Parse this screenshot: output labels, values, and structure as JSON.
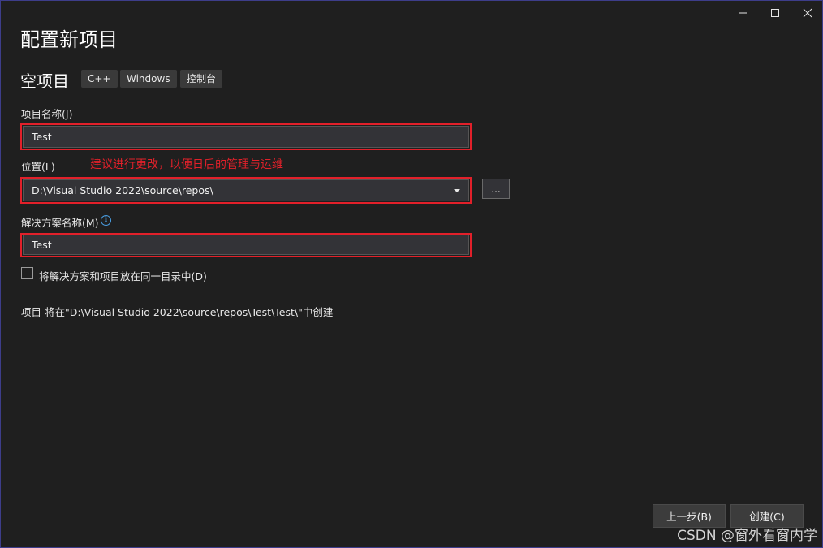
{
  "window": {
    "title": "配置新项目",
    "controls": [
      "minimize-icon",
      "maximize-icon",
      "close-icon"
    ]
  },
  "template": {
    "name": "空项目",
    "tags": [
      "C++",
      "Windows",
      "控制台"
    ]
  },
  "project_name": {
    "label": "项目名称(J)",
    "value": "Test"
  },
  "location": {
    "label": "位置(L)",
    "value": "D:\\Visual Studio 2022\\source\\repos\\",
    "browse_label": "..."
  },
  "annotation": "建议进行更改，以便日后的管理与运维",
  "solution_name": {
    "label": "解决方案名称(M)",
    "value": "Test",
    "info_icon": "info-icon"
  },
  "same_dir_checkbox": {
    "label": "将解决方案和项目放在同一目录中(D)",
    "checked": false
  },
  "summary": "项目 将在\"D:\\Visual Studio 2022\\source\\repos\\Test\\Test\\\"中创建",
  "footer": {
    "back_label": "上一步(B)",
    "create_label": "创建(C)"
  },
  "watermark": "CSDN @窗外看窗内学",
  "colors": {
    "background": "#1f1f1f",
    "field": "#333337",
    "highlight_red": "#e2202a",
    "info_blue": "#4aa0e6"
  }
}
